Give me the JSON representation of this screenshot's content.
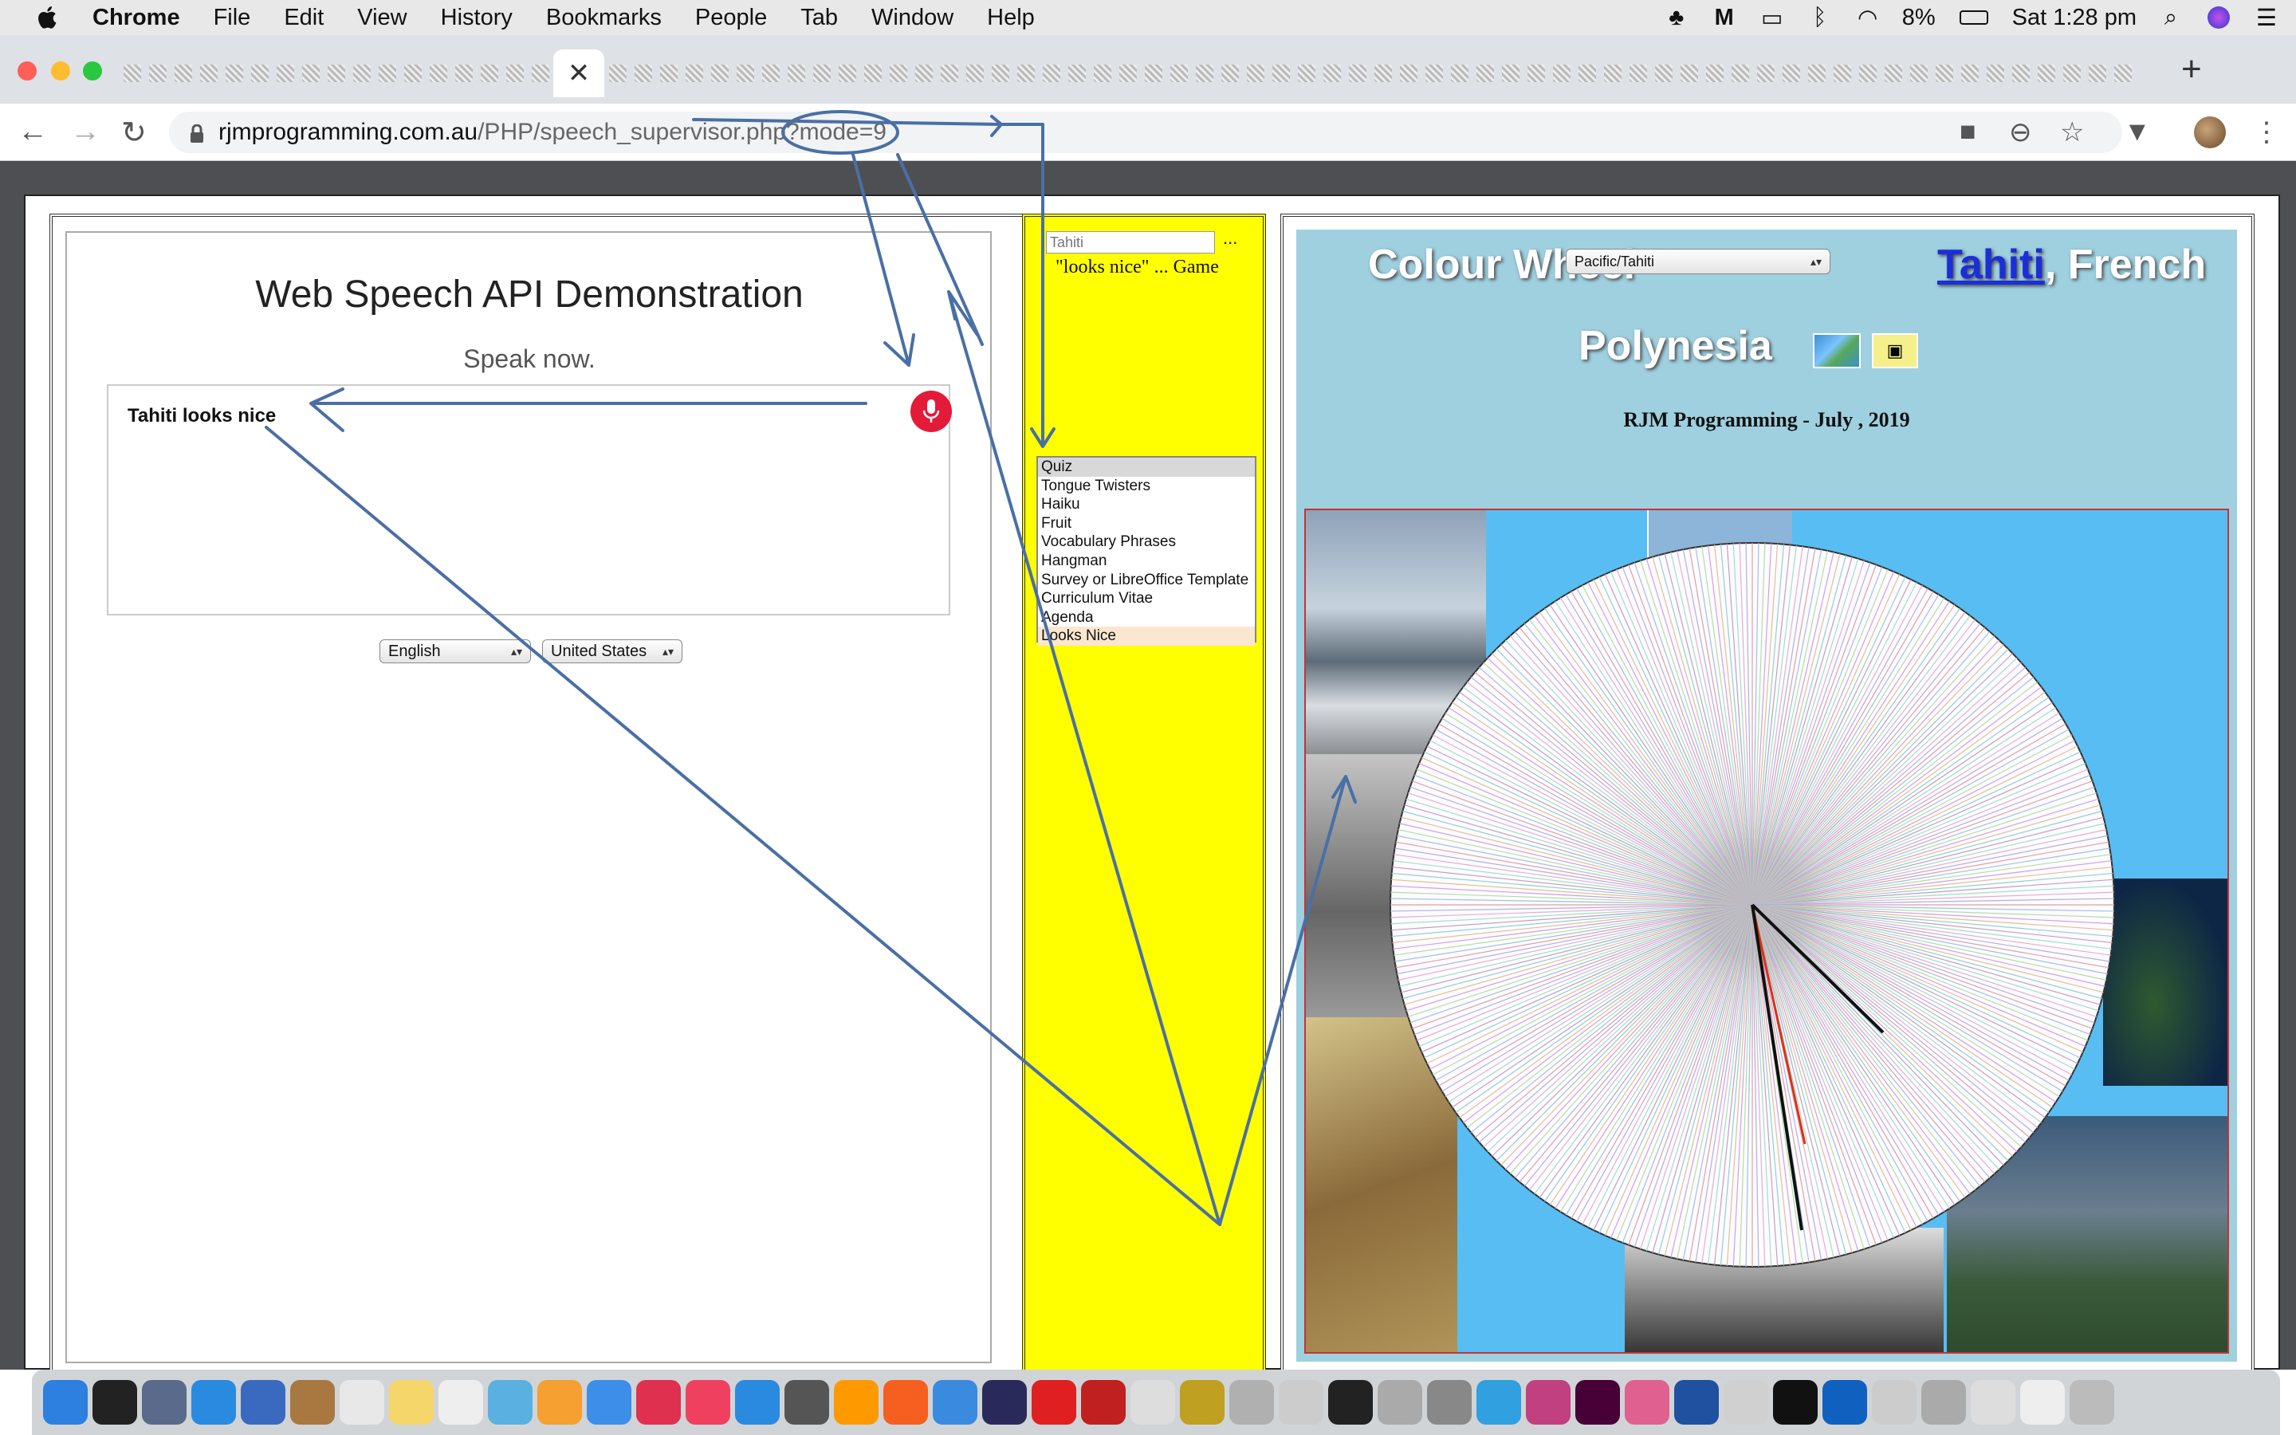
{
  "menubar": {
    "app_name": "Chrome",
    "items": [
      "File",
      "Edit",
      "View",
      "History",
      "Bookmarks",
      "People",
      "Tab",
      "Window",
      "Help"
    ],
    "battery": "8%",
    "clock": "Sat 1:28 pm"
  },
  "tabs": {
    "close_glyph": "✕",
    "new_tab_glyph": "+"
  },
  "toolbar": {
    "url_host": "rjmprogramming.com.au",
    "url_path": "/PHP/speech_supervisor.php?mode=9",
    "back": "←",
    "forward": "→",
    "reload": "↻"
  },
  "speech": {
    "title_part1": "Web Speech API",
    "title_part2": " Demonstration",
    "status": "Speak now.",
    "transcript": "Tahiti looks nice",
    "language": "English",
    "dialect": "United States"
  },
  "middle": {
    "input_value": "Tahiti",
    "ellipsis": "...",
    "game_label": "\"looks nice\" ... Game",
    "list_items": [
      "Quiz",
      "Tongue Twisters",
      "Haiku",
      "Fruit",
      "Vocabulary Phrases",
      "Hangman",
      "Survey or LibreOffice Template",
      "Curriculum Vitae",
      "Agenda",
      "Looks Nice"
    ],
    "selected": "Looks Nice"
  },
  "wheel": {
    "title_prefix": "Colour Wheel",
    "timezone": "Pacific/Tahiti",
    "place_link": "Tahiti",
    "place_rest_1": ", French",
    "place_rest_2": "Polynesia",
    "credit": "RJM Programming - July , 2019"
  },
  "colors": {
    "mid_bg": "#ffff00",
    "wheel_bg": "#9fd0e0",
    "mic": "#e31a38",
    "annotation": "#4a6fa5"
  }
}
